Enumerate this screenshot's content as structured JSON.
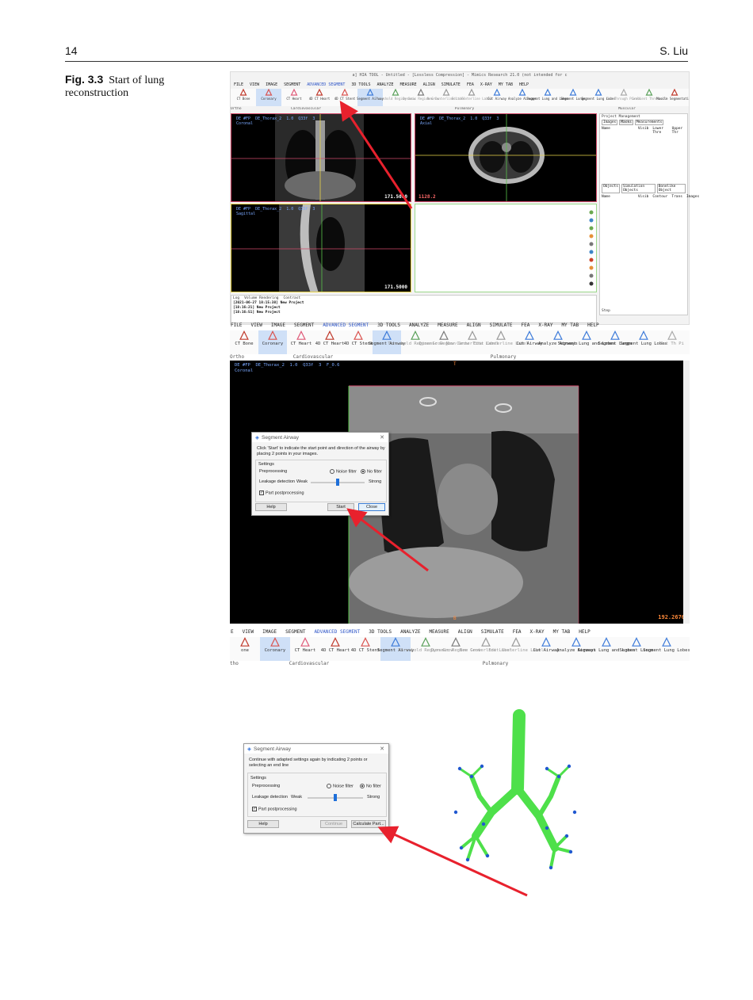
{
  "page_number": "14",
  "author": "S. Liu",
  "figure": {
    "label": "Fig. 3.3",
    "caption": "Start of lung reconstruction"
  },
  "colors": {
    "accent": "#2e55c7",
    "arrow": "#e8212d",
    "airway": "#4ee04a",
    "airway_dots": "#2058d0"
  },
  "top_window": {
    "title": "a] HIA TOOL - Untitled - [Lossless Compression] - Mimics Research 21.0 (not intended for c",
    "menu": [
      "FILE",
      "VIEW",
      "IMAGE",
      "SEGMENT",
      "ADVANCED SEGMENT",
      "3D TOOLS",
      "ANALYZE",
      "MEASURE",
      "ALIGN",
      "SIMULATE",
      "FEA",
      "X-RAY",
      "MY TAB",
      "HELP"
    ],
    "ribbon": [
      "CT Bone",
      "Coronary",
      "CT Heart",
      "4D CT Heart",
      "4D CT Stent",
      "Segment Airway",
      "Threshold Region Grow",
      "Dynamic Region Grow",
      "New Centerline Label",
      "Edit Centerline Label",
      "Cut Airway",
      "Analyze Airways",
      "Segment Lung and Lobes",
      "Segment Lungs",
      "Segment Lung Lobes",
      "Cut Through Pixels",
      "Gradient Threshold",
      "Muscle Segmentation"
    ],
    "groups": [
      "Ortho",
      "Cardiovascular",
      "Pulmonary",
      "Muscular"
    ],
    "viewports": {
      "coronal": {
        "label": "DE #FP  DE_Thorax_2  1.0  Q33f  3\nCoronal",
        "value": "171.5000"
      },
      "axial": {
        "label": "DE #FP  DE_Thorax_2  1.0  Q33f  3\nAxial",
        "value": "1128.2"
      },
      "sagittal": {
        "label": "DE #FP  DE_Thorax_2  1.0  Q33f  3\nSagittal",
        "value": "171.5000"
      }
    },
    "project_panel": {
      "title": "Project Management",
      "tabs": [
        "Images",
        "Masks",
        "Measurements"
      ],
      "columns": [
        "Name",
        "Visib",
        "Lower Thre",
        "Upper Thr"
      ],
      "tabs2": [
        "Objects",
        "Simulation Objects",
        "Bonelike Object"
      ],
      "columns2": [
        "Name",
        "Visib",
        "Contour",
        "Trans",
        "Images"
      ],
      "status": "Step"
    },
    "log": {
      "tabs": [
        "Log",
        "Volume Rendering",
        "Contrast"
      ],
      "lines": [
        "[2021-06-27 18:15:38] New Project",
        "[18:16:21] New Project",
        "[18:16:51] New Project"
      ]
    }
  },
  "middle_window": {
    "menu": [
      "FILE",
      "VIEW",
      "IMAGE",
      "SEGMENT",
      "ADVANCED SEGMENT",
      "3D TOOLS",
      "ANALYZE",
      "MEASURE",
      "ALIGN",
      "SIMULATE",
      "FEA",
      "X-RAY",
      "MY TAB",
      "HELP"
    ],
    "ribbon": [
      "CT Bone",
      "Coronary",
      "CT Heart",
      "4D CT Heart",
      "4D CT Stent",
      "Segment Airway",
      "Threshold Region Grow",
      "Dynamic Region Grow",
      "New Centerline Label",
      "Edit Centerline Label",
      "Cut Airway",
      "Analyze Airways",
      "Segment Lung and Lobes",
      "Segment Lungs",
      "Segment Lung Lobes",
      "Cut Th Pi"
    ],
    "groups": [
      "Ortho",
      "Cardiovascular",
      "Pulmonary"
    ],
    "viewport": {
      "label": "DE #FP  DE_Thorax_2  1.0  Q33f  3  F_0.6\nCoronal",
      "top_marker": "T",
      "bottom_marker": "B",
      "right_marker": "L",
      "value": "192.2676"
    },
    "dialog": {
      "title": "Segment Airway",
      "instruction": "Click 'Start' to indicate the start point and direction of the airway by placing 2 points in your images.",
      "settings_label": "Settings",
      "preprocessing_label": "Preprocessing",
      "noise_filter": "Noise filter",
      "no_filter": "No filter",
      "leakage_label": "Leakage detection",
      "weak": "Weak",
      "strong": "Strong",
      "slider_level": 0.5,
      "part_post": "Part postprocessing",
      "help": "Help",
      "start": "Start",
      "close": "Close"
    }
  },
  "bottom_ribbon": {
    "menu": [
      "E",
      "VIEW",
      "IMAGE",
      "SEGMENT",
      "ADVANCED SEGMENT",
      "3D TOOLS",
      "ANALYZE",
      "MEASURE",
      "ALIGN",
      "SIMULATE",
      "FEA",
      "X-RAY",
      "MY TAB",
      "HELP"
    ],
    "ribbon": [
      "one",
      "Coronary",
      "CT Heart",
      "4D CT Heart",
      "4D CT Stent",
      "Segment Airway",
      "Threshold Region Grow",
      "Dynamic Region Grow",
      "New Centerline Label",
      "Edit Centerline Label",
      "Cut Airway",
      "Analyze Airways",
      "Segment Lung and Lobes",
      "Segment Lungs",
      "Segment Lung Lobes"
    ],
    "groups": [
      "tho",
      "Cardiovascular",
      "Pulmonary"
    ]
  },
  "bottom_dialog": {
    "title": "Segment Airway",
    "instruction": "Continue with adapted settings again by indicating 2 points or selecting an end line",
    "settings_label": "Settings",
    "preprocessing_label": "Preprocessing",
    "noise_filter": "Noise filter",
    "no_filter": "No filter",
    "leakage_label": "Leakage detection",
    "weak": "Weak",
    "strong": "Strong",
    "slider_level": 0.5,
    "part_post": "Part postprocessing",
    "help": "Help",
    "continue": "Continue",
    "calculate": "Calculate Part..."
  }
}
